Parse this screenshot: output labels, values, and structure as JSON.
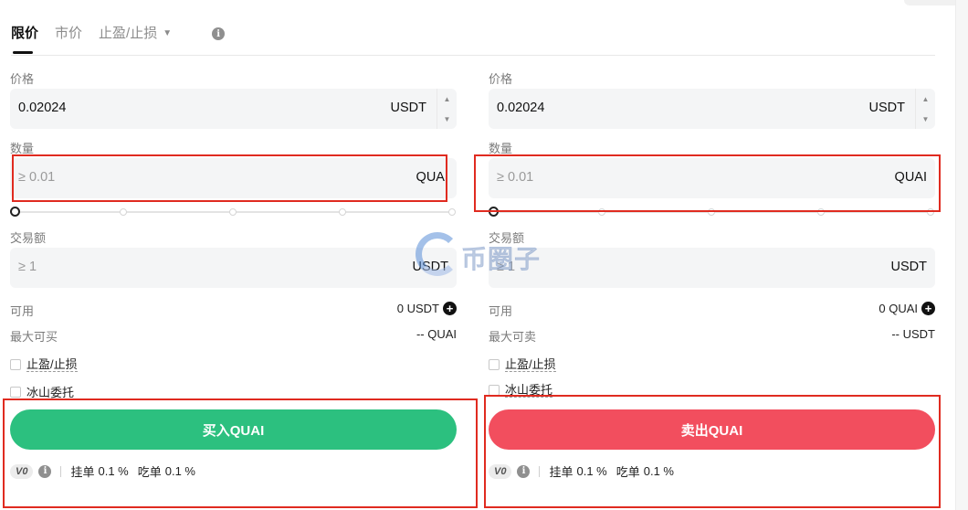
{
  "tabs": {
    "limit": "限价",
    "market": "市价",
    "tpsl": "止盈/止损"
  },
  "buy": {
    "price_label": "价格",
    "price_value": "0.02024",
    "price_unit": "USDT",
    "qty_label": "数量",
    "qty_placeholder": "≥ 0.01",
    "qty_unit": "QUAI",
    "amount_label": "交易额",
    "amount_placeholder": "≥ 1",
    "amount_unit": "USDT",
    "available_label": "可用",
    "available_value": "0 USDT",
    "max_label": "最大可买",
    "max_value": "-- QUAI",
    "tpsl_label": "止盈/止损",
    "iceberg_label": "冰山委托",
    "button_label": "买入QUAI",
    "vip_label": "V0",
    "maker_label": "挂单",
    "maker_value": "0.1 %",
    "taker_label": "吃单",
    "taker_value": "0.1 %"
  },
  "sell": {
    "price_label": "价格",
    "price_value": "0.02024",
    "price_unit": "USDT",
    "qty_label": "数量",
    "qty_placeholder": "≥ 0.01",
    "qty_unit": "QUAI",
    "amount_label": "交易额",
    "amount_placeholder": "≥ 1",
    "amount_unit": "USDT",
    "available_label": "可用",
    "available_value": "0 QUAI",
    "max_label": "最大可卖",
    "max_value": "-- USDT",
    "tpsl_label": "止盈/止损",
    "iceberg_label": "冰山委托",
    "button_label": "卖出QUAI",
    "vip_label": "V0",
    "maker_label": "挂单",
    "maker_value": "0.1 %",
    "taker_label": "吃单",
    "taker_value": "0.1 %"
  },
  "watermark": {
    "text": "币圈子"
  },
  "colors": {
    "buy": "#2cc07f",
    "sell": "#f24e5e",
    "highlight": "#e02b20"
  }
}
